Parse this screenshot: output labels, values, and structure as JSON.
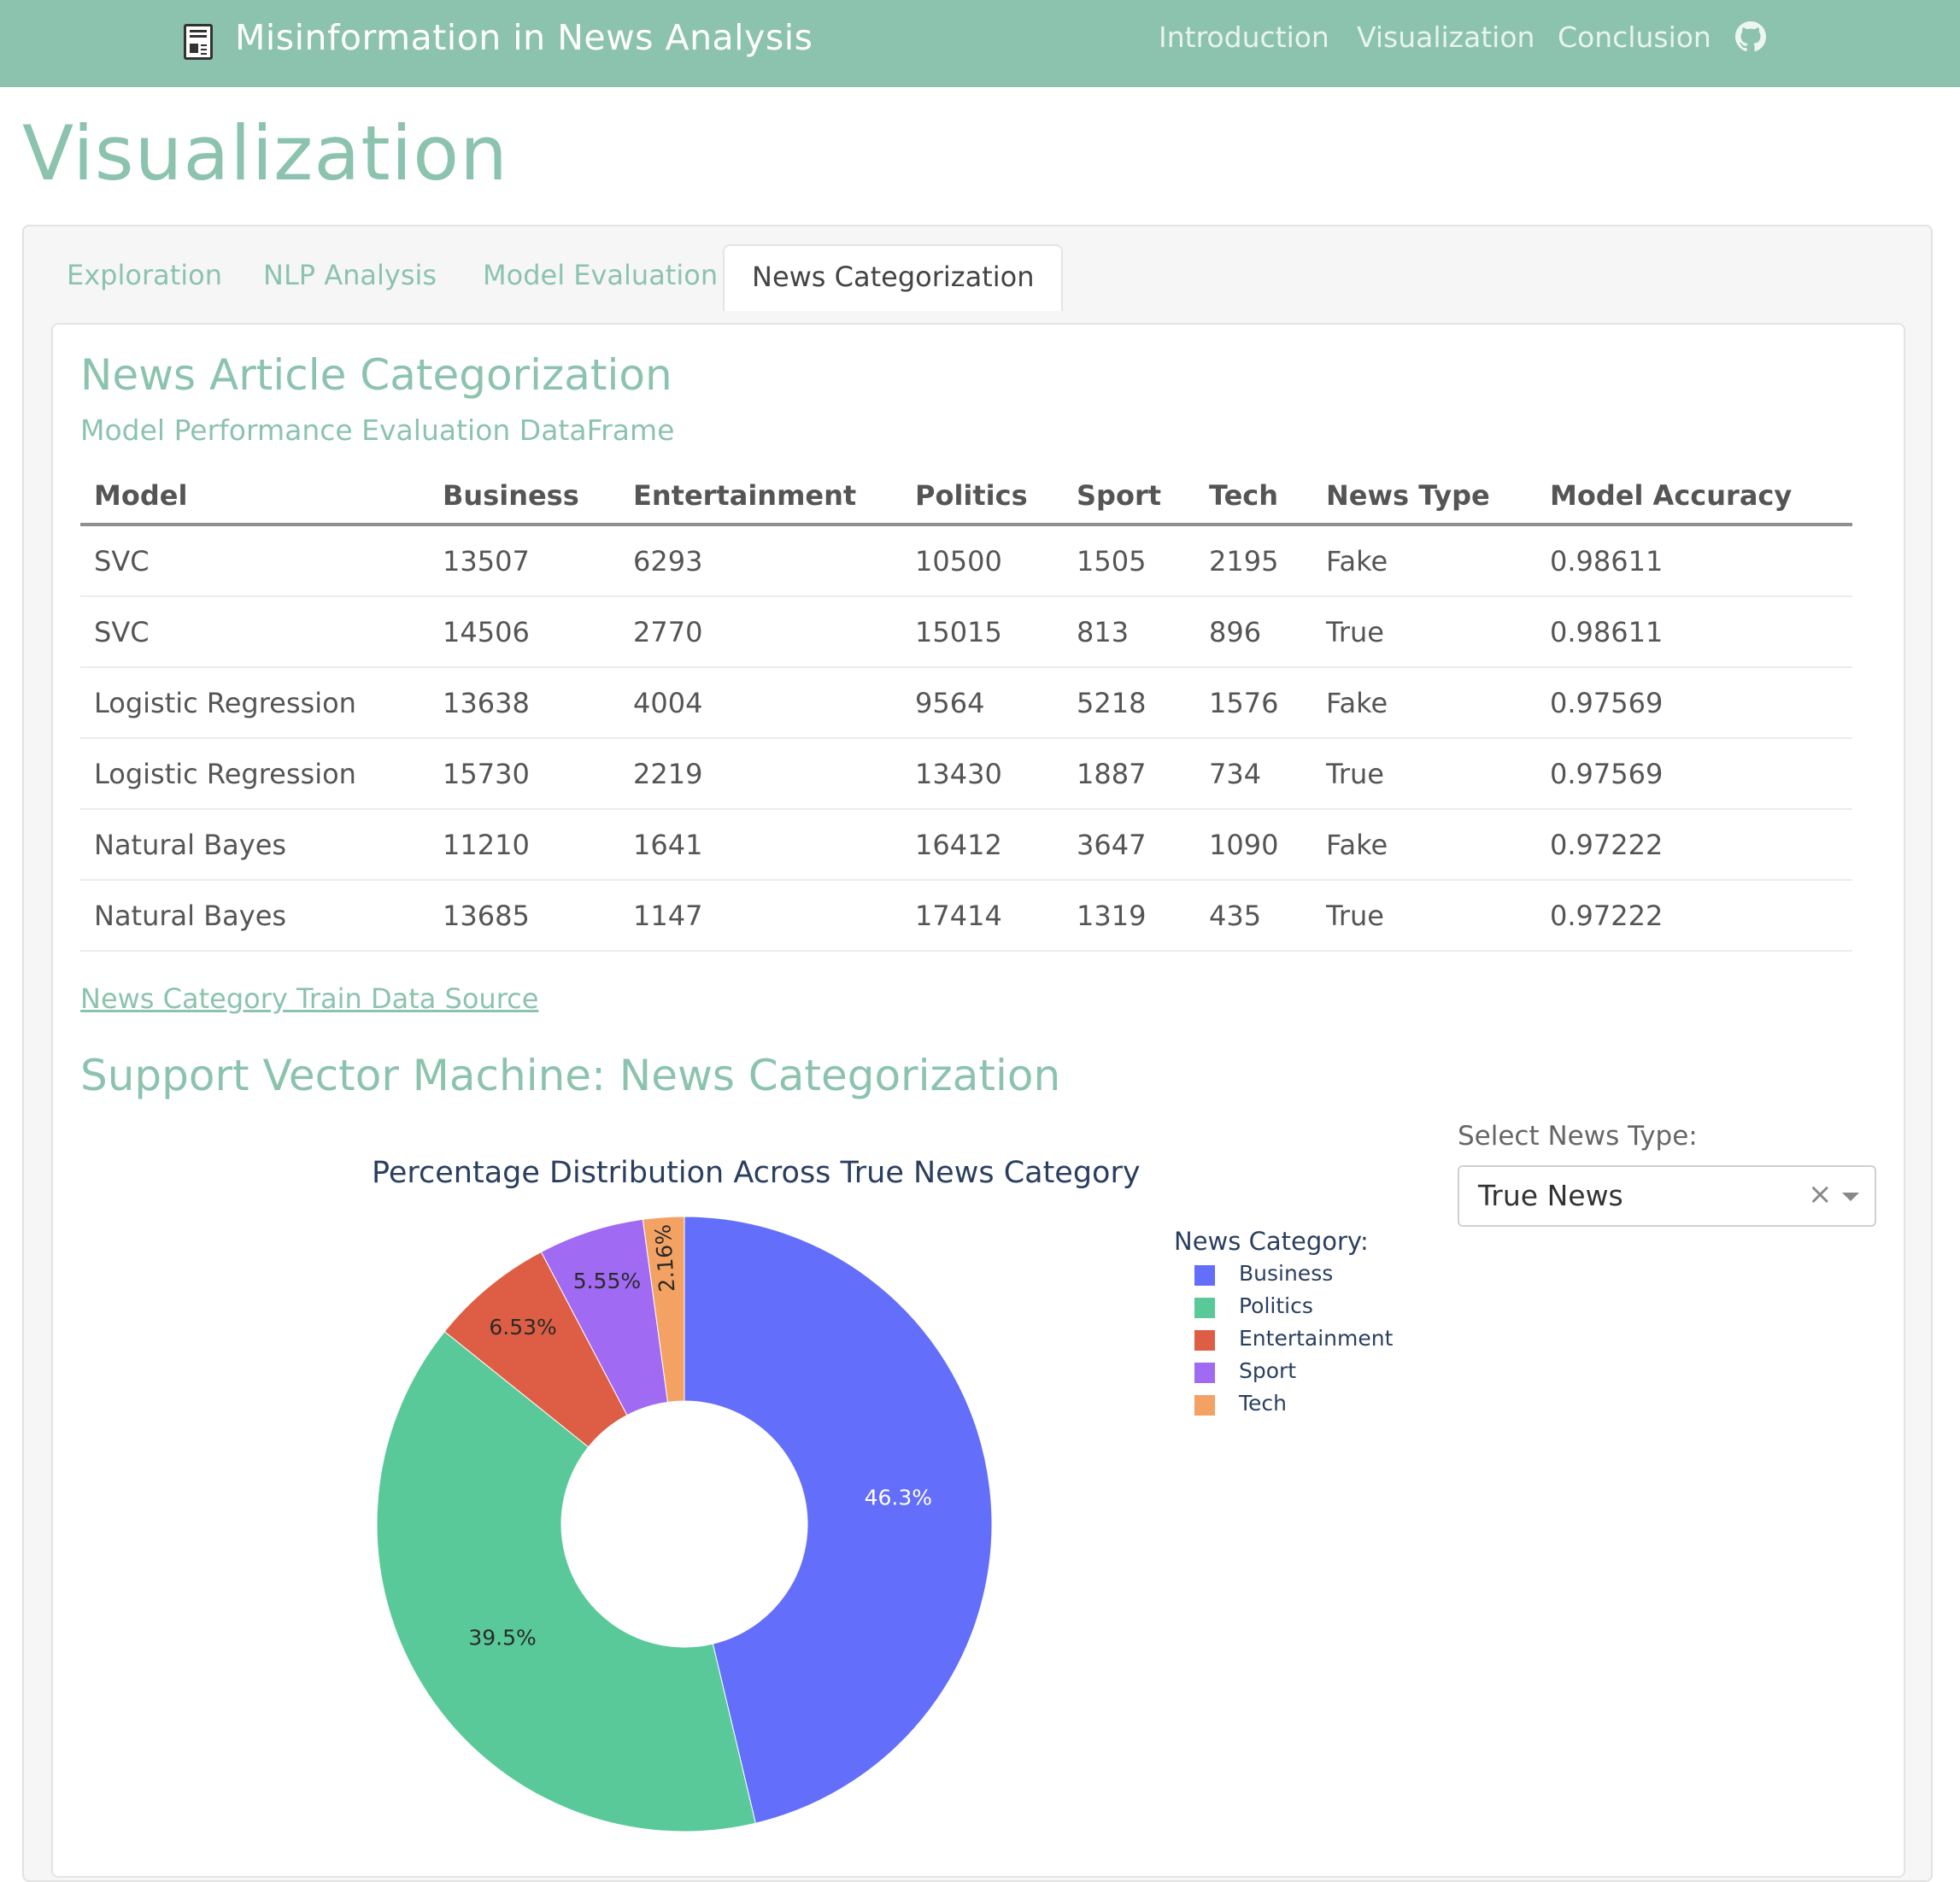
{
  "navbar": {
    "brand_title": "Misinformation in News Analysis",
    "brand_icon": "newspaper-icon",
    "links": [
      "Introduction",
      "Visualization",
      "Conclusion"
    ],
    "github_icon": "github-icon"
  },
  "page": {
    "title": "Visualization"
  },
  "tabs": [
    "Exploration",
    "NLP Analysis",
    "Model Evaluation",
    "News Categorization"
  ],
  "active_tab": "News Categorization",
  "section": {
    "title": "News Article Categorization",
    "subtitle": "Model Performance Evaluation DataFrame"
  },
  "table": {
    "headers": [
      "Model",
      "Business",
      "Entertainment",
      "Politics",
      "Sport",
      "Tech",
      "News Type",
      "Model Accuracy"
    ],
    "rows": [
      [
        "SVC",
        "13507",
        "6293",
        "10500",
        "1505",
        "2195",
        "Fake",
        "0.98611"
      ],
      [
        "SVC",
        "14506",
        "2770",
        "15015",
        "813",
        "896",
        "True",
        "0.98611"
      ],
      [
        "Logistic Regression",
        "13638",
        "4004",
        "9564",
        "5218",
        "1576",
        "Fake",
        "0.97569"
      ],
      [
        "Logistic Regression",
        "15730",
        "2219",
        "13430",
        "1887",
        "734",
        "True",
        "0.97569"
      ],
      [
        "Natural Bayes",
        "11210",
        "1641",
        "16412",
        "3647",
        "1090",
        "Fake",
        "0.97222"
      ],
      [
        "Natural Bayes",
        "13685",
        "1147",
        "17414",
        "1319",
        "435",
        "True",
        "0.97222"
      ]
    ]
  },
  "data_link": "News Category Train Data Source",
  "svm_title": "Support Vector Machine: News Categorization",
  "select": {
    "label": "Select News Type:",
    "value": "True News"
  },
  "chart_data": {
    "type": "pie",
    "title": "Percentage Distribution Across True News Category",
    "legend_title": "News Category:",
    "hole": true,
    "categories": [
      "Business",
      "Politics",
      "Entertainment",
      "Sport",
      "Tech"
    ],
    "values": [
      46.3,
      39.5,
      6.53,
      5.55,
      2.16
    ],
    "labels": [
      "46.3%",
      "39.5%",
      "6.53%",
      "5.55%",
      "2.16%"
    ],
    "colors": [
      "#636efa",
      "#5ac99a",
      "#de5e45",
      "#a06af2",
      "#f4a263"
    ],
    "legend_position": "right"
  }
}
